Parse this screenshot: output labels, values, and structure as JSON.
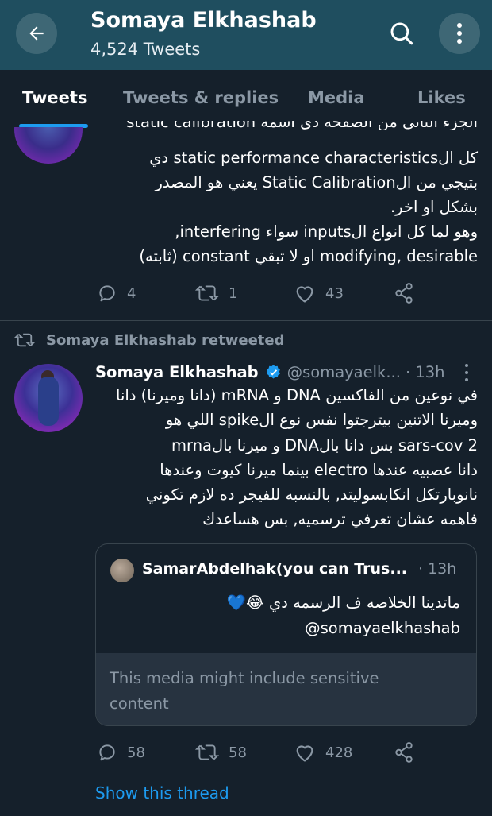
{
  "header": {
    "title": "Somaya Elkhashab",
    "subtitle": "4,524 Tweets"
  },
  "tabs": [
    {
      "label": "Tweets",
      "active": true
    },
    {
      "label": "Tweets & replies",
      "active": false
    },
    {
      "label": "Media",
      "active": false
    },
    {
      "label": "Likes",
      "active": false
    }
  ],
  "tweet1": {
    "lines": [
      "الجزء التاني من الصفحه دي اسمه static calibration",
      "كل الstatic performance characteristics دي",
      "بتيجي من الStatic Calibration يعني هو المصدر",
      "بشكل او اخر.",
      "وهو لما كل انواع الinputs سواء interfering,",
      "modifying, desirable او لا تبقي constant (ثابته)"
    ],
    "replies": "4",
    "retweets": "1",
    "likes": "43"
  },
  "retweet_context": "Somaya Elkhashab retweeted",
  "tweet2": {
    "name": "Somaya Elkhashab",
    "handle": "@somayaelk...",
    "time": "· 13h",
    "lines": [
      "في نوعين من الفاكسين DNA و mRNA (دانا وميرنا) دانا",
      "وميرنا الاتنين بيترجتوا نفس نوع الspike اللي هو",
      "sars-cov 2 بس دانا بالDNA و ميرنا بالmrna",
      "دانا عصبيه عندها electro بينما ميرنا كيوت وعندها",
      "نانوبارتكل انكابسوليتد, بالنسبه للفيجر ده لازم تكوني",
      "فاهمه عشان تعرفي ترسميه, بس هساعدك"
    ],
    "quote": {
      "name": "SamarAbdelhak(you can Trus...",
      "time": "· 13h",
      "line1": "ماتدينا الخلاصه ف الرسمه دي 😂💙",
      "line2": "@somayaelkhashab",
      "sensitive": "This media might include sensitive content"
    },
    "replies": "58",
    "retweets": "58",
    "likes": "428",
    "show_thread": "Show this thread"
  },
  "colors": {
    "header_bg": "#1f4e5f",
    "background": "#15202b",
    "accent": "#1d9bf0",
    "muted": "#8b98a5"
  }
}
